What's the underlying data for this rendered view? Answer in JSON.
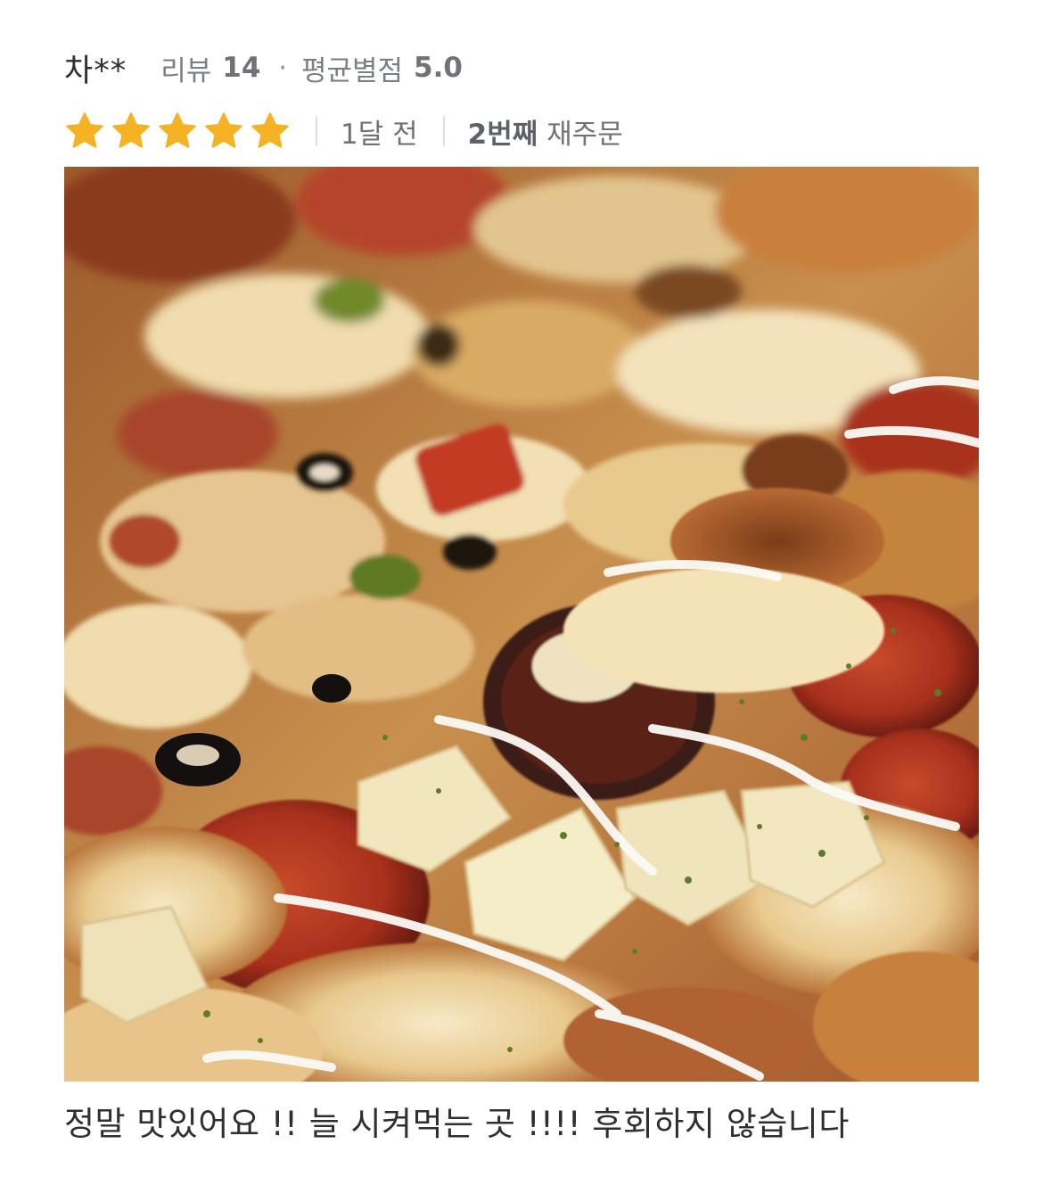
{
  "review": {
    "reviewer": "차**",
    "review_count_label": "리뷰",
    "review_count": "14",
    "avg_rating_label": "평균별점",
    "avg_rating": "5.0",
    "separator": "·",
    "stars": 5,
    "max_stars": 5,
    "time_ago": "1달 전",
    "reorder_count": "2번째",
    "reorder_label": "재주문",
    "body": "정말 맛있어요 !! 늘 시켜먹는 곳 !!!! 후회하지 않습니다",
    "photo_subject": "pizza-photo"
  },
  "colors": {
    "star": "#f5b324",
    "muted_text": "#7a7f86",
    "primary_text": "#2f2f2f"
  }
}
